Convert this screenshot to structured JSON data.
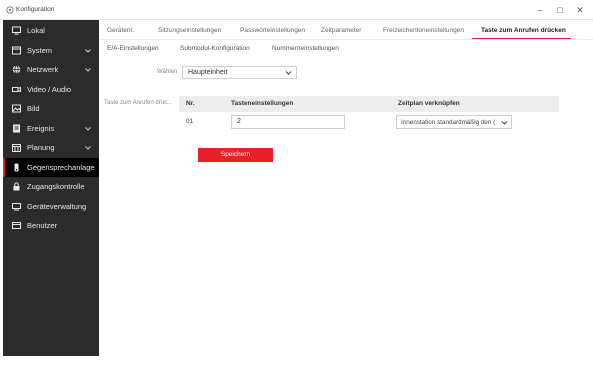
{
  "window": {
    "title": "Konfiguration",
    "controls": {
      "minimize": "–",
      "maximize": "□",
      "close": "✕"
    }
  },
  "sidebar": {
    "items": [
      {
        "label": "Lokal",
        "icon": "monitor-icon",
        "has_chevron": false
      },
      {
        "label": "System",
        "icon": "system-icon",
        "has_chevron": true
      },
      {
        "label": "Netzwerk",
        "icon": "globe-icon",
        "has_chevron": true
      },
      {
        "label": "Video / Audio",
        "icon": "camera-icon",
        "has_chevron": false
      },
      {
        "label": "Bild",
        "icon": "image-icon",
        "has_chevron": false
      },
      {
        "label": "Ereignis",
        "icon": "event-icon",
        "has_chevron": true
      },
      {
        "label": "Planung",
        "icon": "calendar-icon",
        "has_chevron": true
      },
      {
        "label": "Gegensprechanlage",
        "icon": "intercom-icon",
        "has_chevron": false,
        "active": true
      },
      {
        "label": "Zugangskontrolle",
        "icon": "lock-icon",
        "has_chevron": false
      },
      {
        "label": "Geräteverwaltung",
        "icon": "device-icon",
        "has_chevron": false
      },
      {
        "label": "Benutzer",
        "icon": "user-icon",
        "has_chevron": false
      }
    ]
  },
  "tabs_primary": [
    {
      "label": "Gerätenr."
    },
    {
      "label": "Sitzungseinstellungen"
    },
    {
      "label": "Passworteinstellungen"
    },
    {
      "label": "Zeitparameter"
    },
    {
      "label": "Freizeichentoneinstellungen"
    },
    {
      "label": "Taste zum Anrufen drücken",
      "active": true
    }
  ],
  "tabs_secondary": [
    {
      "label": "E/A-Einstellungen"
    },
    {
      "label": "Submodul-Konfiguration"
    },
    {
      "label": "Nummerneinstellungen"
    }
  ],
  "form": {
    "select_label": "Wählen",
    "select_value": "Haupteinheit",
    "section_label": "Taste zum Anrufen drüc...",
    "table": {
      "headers": [
        "Nr.",
        "Tasteneinstellungen",
        "Zeitplan verknüpfen"
      ],
      "rows": [
        {
          "nr": "01",
          "value": "2",
          "schedule": "Innenstation standardmäßig den ("
        }
      ]
    },
    "save_label": "Speichern"
  },
  "colors": {
    "accent": "#e8202a",
    "sidebar_bg": "#2b2b2b",
    "sidebar_active": "#000000"
  }
}
